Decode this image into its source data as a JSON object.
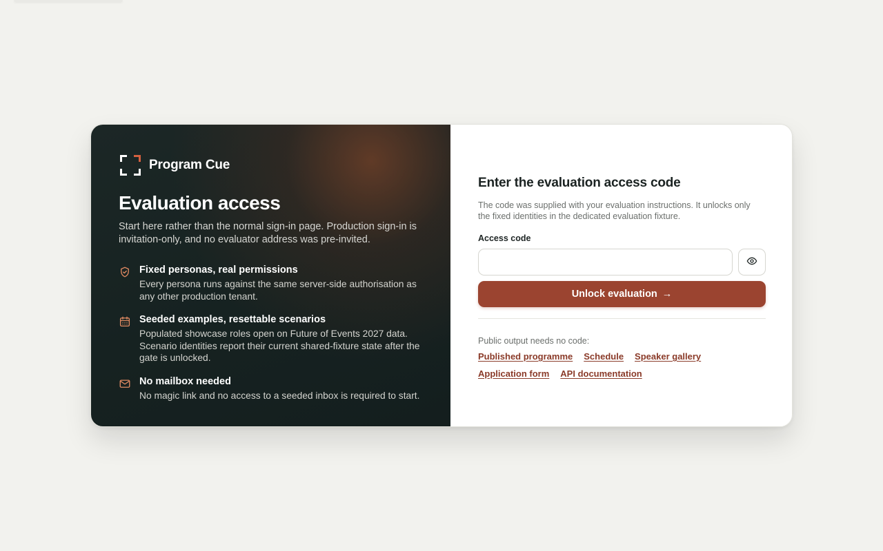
{
  "brand": {
    "name": "Program Cue",
    "accent_color": "#d4603f"
  },
  "left": {
    "title": "Evaluation access",
    "intro": "Start here rather than the normal sign-in page. Production sign-in is invitation-only, and no evaluator address was pre-invited.",
    "features": [
      {
        "icon": "shield-check-icon",
        "title": "Fixed personas, real permissions",
        "description": "Every persona runs against the same server-side authorisation as any other production tenant."
      },
      {
        "icon": "calendar-icon",
        "title": "Seeded examples, resettable scenarios",
        "description": "Populated showcase roles open on Future of Events 2027 data. Scenario identities report their current shared-fixture state after the gate is unlocked."
      },
      {
        "icon": "mail-icon",
        "title": "No mailbox needed",
        "description": "No magic link and no access to a seeded inbox is required to start."
      }
    ]
  },
  "right": {
    "title": "Enter the evaluation access code",
    "help": "The code was supplied with your evaluation instructions. It unlocks only the fixed identities in the dedicated evaluation fixture.",
    "field_label": "Access code",
    "field_value": "",
    "field_placeholder": "",
    "reveal_icon": "eye-icon",
    "submit_label": "Unlock evaluation",
    "submit_arrow": "→",
    "button_color": "#9b4430",
    "public_label": "Public output needs no code:",
    "links": [
      "Published programme",
      "Schedule",
      "Speaker gallery",
      "Application form",
      "API documentation"
    ]
  }
}
